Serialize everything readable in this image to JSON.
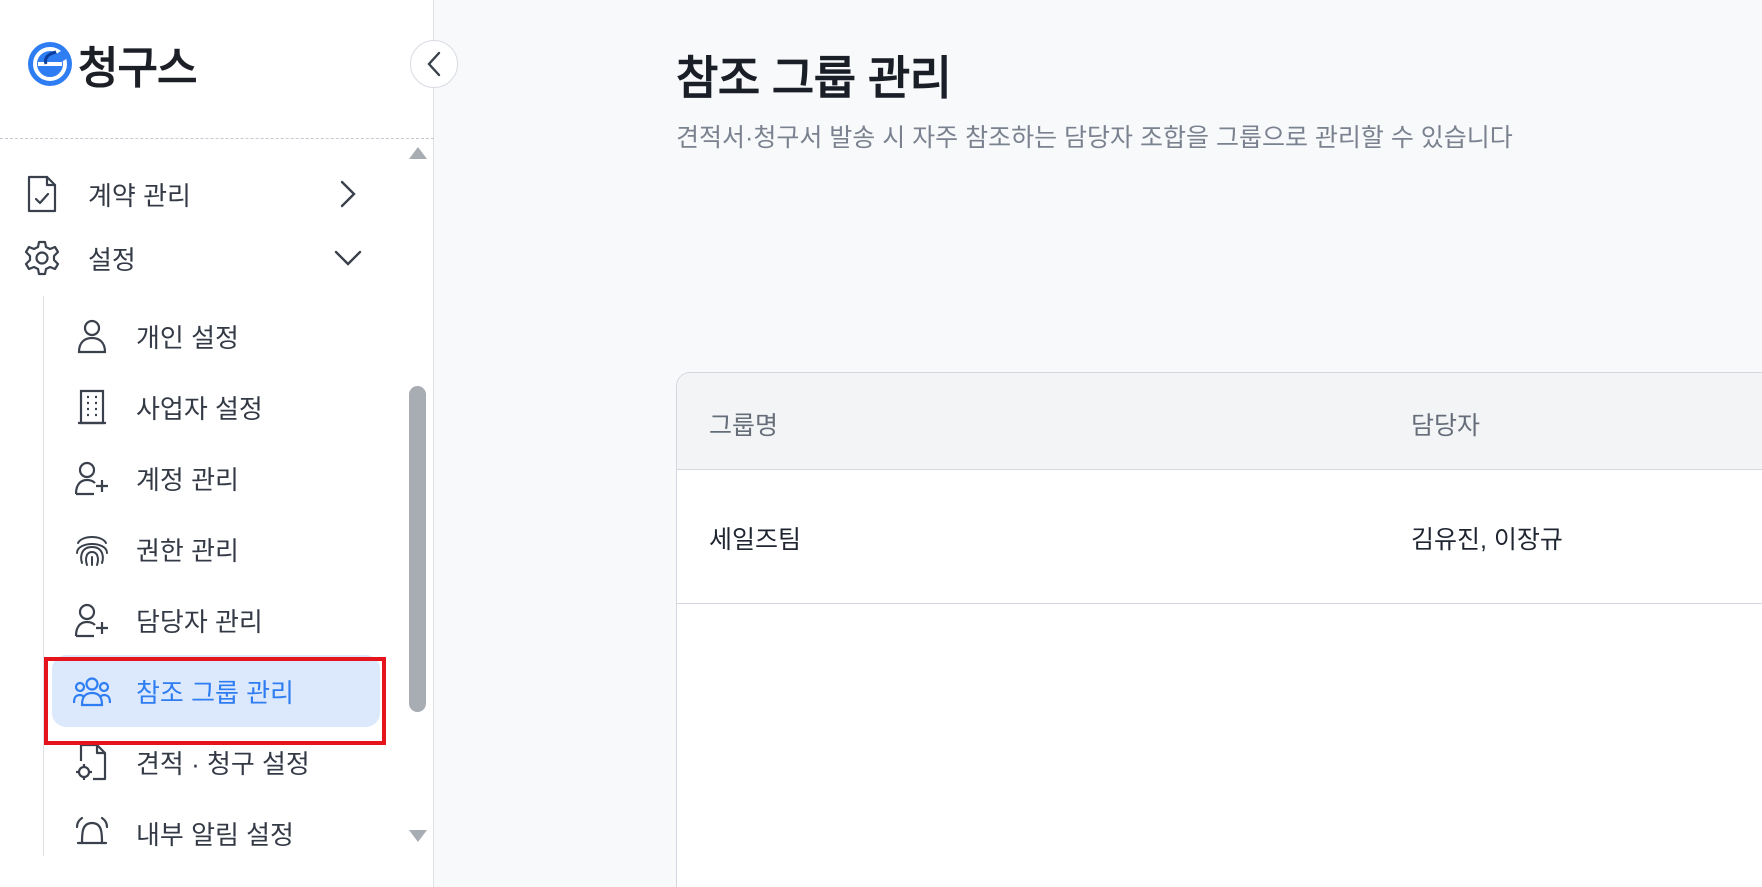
{
  "app": {
    "name": "청구스"
  },
  "sidebar": {
    "collapse_icon": "chevron-left-icon",
    "top_items": [
      {
        "label": "계약 관리",
        "icon": "file-check-icon",
        "chevron": "chevron-right-icon"
      },
      {
        "label": "설정",
        "icon": "gear-icon",
        "chevron": "chevron-down-icon"
      }
    ],
    "sub_items": [
      {
        "label": "개인 설정",
        "icon": "user-icon"
      },
      {
        "label": "사업자 설정",
        "icon": "building-icon"
      },
      {
        "label": "계정 관리",
        "icon": "user-plus-icon"
      },
      {
        "label": "권한 관리",
        "icon": "fingerprint-icon"
      },
      {
        "label": "담당자 관리",
        "icon": "user-plus-icon"
      },
      {
        "label": "참조 그룹 관리",
        "icon": "users-group-icon",
        "active": true
      },
      {
        "label": "견적 · 청구 설정",
        "icon": "file-gear-icon"
      },
      {
        "label": "내부 알림 설정",
        "icon": "bell-icon"
      }
    ]
  },
  "main": {
    "title": "참조 그룹 관리",
    "description": "견적서·청구서 발송 시 자주 참조하는 담당자 조합을 그룹으로 관리할 수 있습니다",
    "table": {
      "columns": [
        "그룹명",
        "담당자"
      ],
      "rows": [
        [
          "세일즈팀",
          "김유진, 이장규"
        ]
      ]
    }
  },
  "colors": {
    "accent": "#2f7df2",
    "active_bg": "#dce9fc",
    "highlight": "#e5131b"
  }
}
